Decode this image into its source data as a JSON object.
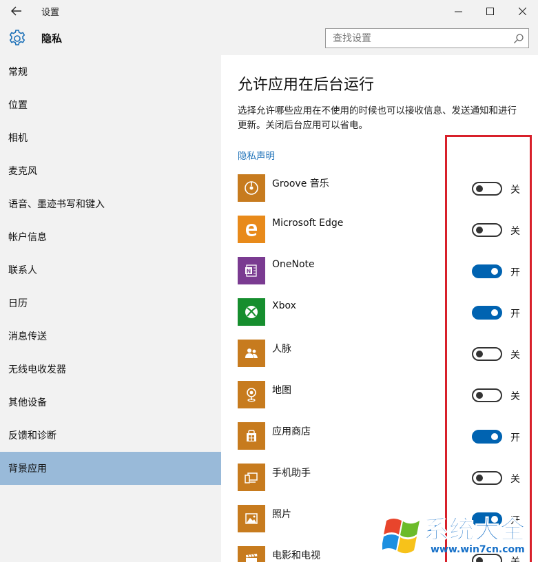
{
  "window": {
    "title": "设置"
  },
  "header": {
    "title": "隐私",
    "search_placeholder": "查找设置"
  },
  "sidebar": {
    "items": [
      {
        "label": "常规"
      },
      {
        "label": "位置"
      },
      {
        "label": "相机"
      },
      {
        "label": "麦克风"
      },
      {
        "label": "语音、墨迹书写和键入"
      },
      {
        "label": "帐户信息"
      },
      {
        "label": "联系人"
      },
      {
        "label": "日历"
      },
      {
        "label": "消息传送"
      },
      {
        "label": "无线电收发器"
      },
      {
        "label": "其他设备"
      },
      {
        "label": "反馈和诊断"
      },
      {
        "label": "背景应用"
      }
    ],
    "active_index": 12
  },
  "main": {
    "title": "允许应用在后台运行",
    "description": "选择允许哪些应用在不使用的时候也可以接收信息、发送通知和进行更新。关闭后台应用可以省电。",
    "privacy_link": "隐私声明",
    "apps": [
      {
        "name": "Groove 音乐",
        "on": false,
        "state_label": "关",
        "tile_color": "#c77b1e",
        "icon": "music-disc-icon"
      },
      {
        "name": "Microsoft Edge",
        "on": false,
        "state_label": "关",
        "tile_color": "#e88a1a",
        "icon": "edge-icon"
      },
      {
        "name": "OneNote",
        "on": true,
        "state_label": "开",
        "tile_color": "#7a3b91",
        "icon": "onenote-icon"
      },
      {
        "name": "Xbox",
        "on": true,
        "state_label": "开",
        "tile_color": "#168e2e",
        "icon": "xbox-icon"
      },
      {
        "name": "人脉",
        "on": false,
        "state_label": "关",
        "tile_color": "#c77b1e",
        "icon": "people-icon"
      },
      {
        "name": "地图",
        "on": false,
        "state_label": "关",
        "tile_color": "#c77b1e",
        "icon": "map-pin-icon"
      },
      {
        "name": "应用商店",
        "on": true,
        "state_label": "开",
        "tile_color": "#c77b1e",
        "icon": "store-icon"
      },
      {
        "name": "手机助手",
        "on": false,
        "state_label": "关",
        "tile_color": "#c77b1e",
        "icon": "phone-companion-icon"
      },
      {
        "name": "照片",
        "on": true,
        "state_label": "开",
        "tile_color": "#c77b1e",
        "icon": "photos-icon"
      },
      {
        "name": "电影和电视",
        "on": false,
        "state_label": "关",
        "tile_color": "#c77b1e",
        "icon": "movies-icon"
      }
    ]
  },
  "watermark": {
    "text": "系统大全",
    "url": "www.win7cn.com"
  },
  "colors": {
    "accent": "#0063b1",
    "active_nav": "#99bad9",
    "link": "#1a6fb7",
    "highlight_box": "#d8202a"
  }
}
